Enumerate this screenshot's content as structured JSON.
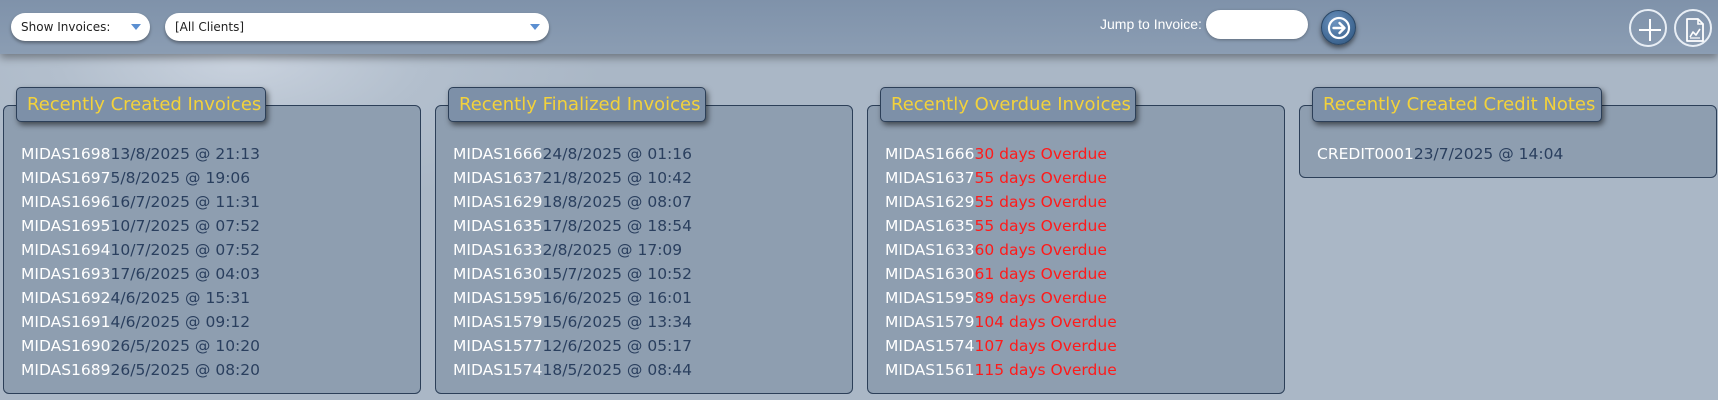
{
  "toolbar": {
    "show_invoices": "Show Invoices:",
    "client_select": "[All Clients]",
    "jump_label": "Jump to Invoice:",
    "jump_value": "",
    "go_icon": "arrow-right-circle-icon",
    "add_icon": "plus-icon",
    "report_icon": "document-chart-icon"
  },
  "colors": {
    "title": "#f3d23b",
    "invoice_number": "#ffffff",
    "date": "#2a3f5e",
    "overdue": "#ff1a1a",
    "panel_bg": "#8e9eb0"
  },
  "panels": {
    "created": {
      "title": "Recently Created Invoices",
      "rows": [
        {
          "invoice": "MIDAS1698",
          "info": "13/8/2025 @ 21:13"
        },
        {
          "invoice": "MIDAS1697",
          "info": "5/8/2025 @ 19:06"
        },
        {
          "invoice": "MIDAS1696",
          "info": "16/7/2025 @ 11:31"
        },
        {
          "invoice": "MIDAS1695",
          "info": "10/7/2025 @ 07:52"
        },
        {
          "invoice": "MIDAS1694",
          "info": "10/7/2025 @ 07:52"
        },
        {
          "invoice": "MIDAS1693",
          "info": "17/6/2025 @ 04:03"
        },
        {
          "invoice": "MIDAS1692",
          "info": "4/6/2025 @ 15:31"
        },
        {
          "invoice": "MIDAS1691",
          "info": "4/6/2025 @ 09:12"
        },
        {
          "invoice": "MIDAS1690",
          "info": "26/5/2025 @ 10:20"
        },
        {
          "invoice": "MIDAS1689",
          "info": "26/5/2025 @ 08:20"
        }
      ]
    },
    "finalized": {
      "title": "Recently Finalized Invoices",
      "rows": [
        {
          "invoice": "MIDAS1666",
          "info": "24/8/2025 @ 01:16"
        },
        {
          "invoice": "MIDAS1637",
          "info": "21/8/2025 @ 10:42"
        },
        {
          "invoice": "MIDAS1629",
          "info": "18/8/2025 @ 08:07"
        },
        {
          "invoice": "MIDAS1635",
          "info": "17/8/2025 @ 18:54"
        },
        {
          "invoice": "MIDAS1633",
          "info": "2/8/2025 @ 17:09"
        },
        {
          "invoice": "MIDAS1630",
          "info": "15/7/2025 @ 10:52"
        },
        {
          "invoice": "MIDAS1595",
          "info": "16/6/2025 @ 16:01"
        },
        {
          "invoice": "MIDAS1579",
          "info": "15/6/2025 @ 13:34"
        },
        {
          "invoice": "MIDAS1577",
          "info": "12/6/2025 @ 05:17"
        },
        {
          "invoice": "MIDAS1574",
          "info": "18/5/2025 @ 08:44"
        }
      ]
    },
    "overdue": {
      "title": "Recently Overdue Invoices",
      "rows": [
        {
          "invoice": "MIDAS1666",
          "info": "30 days Overdue"
        },
        {
          "invoice": "MIDAS1637",
          "info": "55 days Overdue"
        },
        {
          "invoice": "MIDAS1629",
          "info": "55 days Overdue"
        },
        {
          "invoice": "MIDAS1635",
          "info": "55 days Overdue"
        },
        {
          "invoice": "MIDAS1633",
          "info": "60 days Overdue"
        },
        {
          "invoice": "MIDAS1630",
          "info": "61 days Overdue"
        },
        {
          "invoice": "MIDAS1595",
          "info": "89 days Overdue"
        },
        {
          "invoice": "MIDAS1579",
          "info": "104 days Overdue"
        },
        {
          "invoice": "MIDAS1574",
          "info": "107 days Overdue"
        },
        {
          "invoice": "MIDAS1561",
          "info": "115 days Overdue"
        }
      ]
    },
    "credit": {
      "title": "Recently Created Credit Notes",
      "rows": [
        {
          "invoice": "CREDIT0001",
          "info": "23/7/2025 @ 14:04"
        }
      ]
    }
  }
}
